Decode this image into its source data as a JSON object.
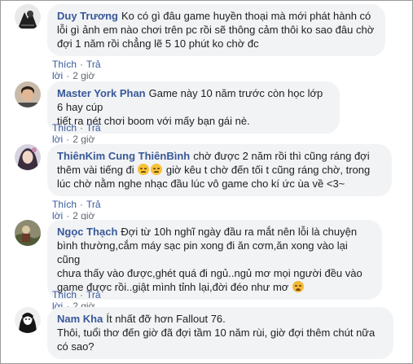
{
  "comments": [
    {
      "author": "Duy Trương",
      "line1": "Ko có gì đâu game huyền thoại mà mới phát hành có",
      "line2": "lỗi gì ảnh em nào chơi trên pc rồi sẽ thông cảm thôi ko sao đâu chờ",
      "line3": "đợi 1 năm rồi chẳng lẽ 5 10 phút ko chờ đc",
      "like": "Thích",
      "reply": "Trả lời",
      "time": "2 giờ"
    },
    {
      "author": "Master York Phan",
      "line1": "Game này 10 năm trước còn học lớp 6 hay cúp",
      "line2": "tiết ra nét chơi boom với mấy bạn gái nè.",
      "like": "Thích",
      "reply": "Trả lời",
      "time": "2 giờ"
    },
    {
      "author": "ThiênKim Cung ThiênBình",
      "line1": "chờ được 2 năm rồi thì cũng ráng đợi",
      "line2a": "thêm vài tiếng đi",
      "line2b": "giờ kêu t chờ đến tối t cũng ráng chờ, trong",
      "line3": "lúc chờ nằm nghe nhạc đầu lúc vô game cho kí ức ùa về <3~",
      "like": "Thích",
      "reply": "Trả lời",
      "time": "2 giờ"
    },
    {
      "author": "Ngọc Thạch",
      "line1": "Đợi từ 10h nghĩ ngày đầu ra mắt nên lỗi là chuyện",
      "line2": "bình thường,cắm máy sạc pin xong đi ăn cơm,ăn xong vào lại cũng",
      "line3": "chưa thấy vào được,ghét quá đi ngủ..ngủ mơ mọi người đều vào",
      "line4": "game được rồi..giật mình tỉnh lại,đời đéo như mơ",
      "like": "Thích",
      "reply": "Trả lời",
      "time": "2 giờ"
    },
    {
      "author": "Nam Kha",
      "line1": "Ít nhất đỡ hơn Fallout 76.",
      "line2": "Thôi, tuổi thơ đến giờ đã đợi tầm 10 năm rùi, giờ đợi thêm chút nữa",
      "line3": "có sao?"
    }
  ],
  "separator": "·",
  "colors": {
    "link": "#385898",
    "bubble": "#f2f3f5",
    "meta": "#606770",
    "text": "#1c1e21"
  },
  "emoji": {
    "grin": "smiling-emoji-icon",
    "sad": "disappointed-emoji-icon"
  }
}
